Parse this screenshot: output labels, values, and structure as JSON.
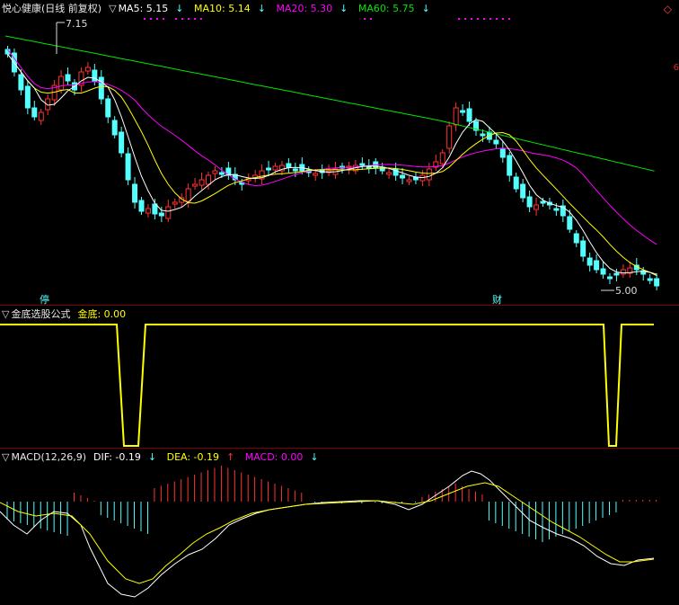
{
  "main_header": {
    "title": "悦心健康(日线 前复权)",
    "ma5": "MA5: 5.15",
    "ma10": "MA10: 5.14",
    "ma20": "MA20: 5.30",
    "ma60": "MA60: 5.75",
    "arrow": "↓",
    "triangle": "▽"
  },
  "main_chart": {
    "high_label": "7.15",
    "low_label": "5.00",
    "marker_left": "停",
    "marker_right": "财",
    "right_edge": "6"
  },
  "indicator_header": {
    "title": "金底选股公式",
    "value_label": "金底: 0.00",
    "triangle": "▽"
  },
  "macd_header": {
    "title": "MACD(12,26,9)",
    "dif": "DIF: -0.19",
    "dea": "DEA: -0.19",
    "macd": "MACD: 0.00",
    "down": "↓",
    "up": "↑",
    "triangle": "▽"
  },
  "colors": {
    "up": "#ff3232",
    "down": "#54ffff",
    "ma5": "#ffffff",
    "ma10": "#ffff00",
    "ma20": "#ff00ff",
    "ma60": "#00e600",
    "border": "#800000",
    "bg": "#000000"
  }
}
